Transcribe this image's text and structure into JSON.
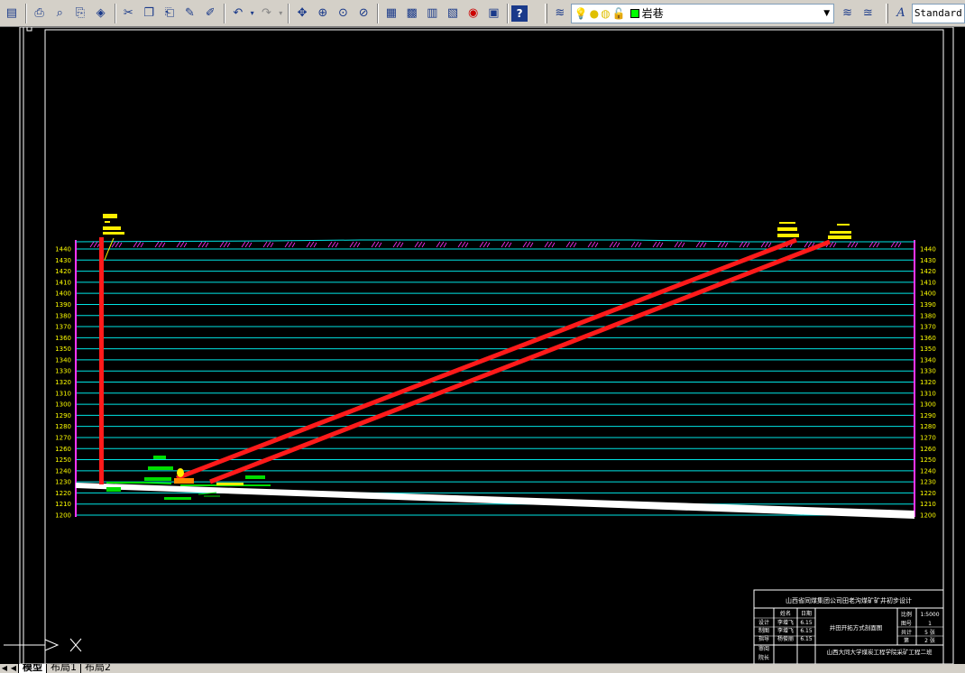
{
  "toolbar": {
    "layer_name": "岩巷",
    "text_style": "Standard",
    "icons": [
      "save-icon",
      "publish-icon",
      "plot-preview-icon",
      "plot-icon",
      "3d-dwf-icon",
      "cut-icon",
      "copy-icon",
      "paste-icon",
      "match-properties-icon",
      "block-editor-icon",
      "undo-icon",
      "redo-icon",
      "pan-icon",
      "zoom-realtime-icon",
      "zoom-window-icon",
      "zoom-previous-icon",
      "properties-icon",
      "design-center-icon",
      "tool-palettes-icon",
      "sheet-set-icon",
      "markup-icon",
      "calculator-icon",
      "help-icon",
      "layer-manager-icon",
      "layer-previous-icon",
      "layer-state-icon",
      "text-style-icon"
    ]
  },
  "colors": {
    "background": "#000000",
    "grid_line": "#00e5e5",
    "elevation_text": "#ffff00",
    "shaft": "#ff1a1a",
    "surface_hatch": "#ff33ff",
    "seam": "#ffffff",
    "roadway": "#00dd00",
    "label_box": "#ffee00",
    "frame": "#ffffff"
  },
  "section": {
    "elev_max": 1440,
    "elev_min": 1200,
    "elev_step": 10,
    "elevations": [
      1440,
      1430,
      1420,
      1410,
      1400,
      1390,
      1380,
      1370,
      1360,
      1350,
      1340,
      1330,
      1320,
      1310,
      1300,
      1290,
      1280,
      1270,
      1260,
      1250,
      1240,
      1230,
      1220,
      1210,
      1200
    ]
  },
  "title_block": {
    "header": "山西省同煤集团公司田老沟煤矿矿井初步设计",
    "drawing_name": "井田开拓方式剖面图",
    "institution": "山西大同大学煤炭工程学院采矿工程二班",
    "col_name": "姓名",
    "col_date": "日期",
    "roles": [
      {
        "role": "设计",
        "name": "李增飞",
        "date": "6.15"
      },
      {
        "role": "制图",
        "name": "李增飞",
        "date": "6.15"
      },
      {
        "role": "指导",
        "name": "杨俊丽",
        "date": "6.15"
      },
      {
        "role": "审阅",
        "name": "",
        "date": ""
      },
      {
        "role": "院长",
        "name": "",
        "date": ""
      }
    ],
    "scale_label": "比例",
    "scale_value": "1:5000",
    "sheet_no_label": "图号",
    "sheet_no_value": "1",
    "total_label": "共计",
    "total_value": "5 张",
    "page_label": "第",
    "page_value": "2 张"
  },
  "tabs": [
    {
      "label": "模型",
      "active": true
    },
    {
      "label": "布局1",
      "active": false
    },
    {
      "label": "布局2",
      "active": false
    }
  ]
}
